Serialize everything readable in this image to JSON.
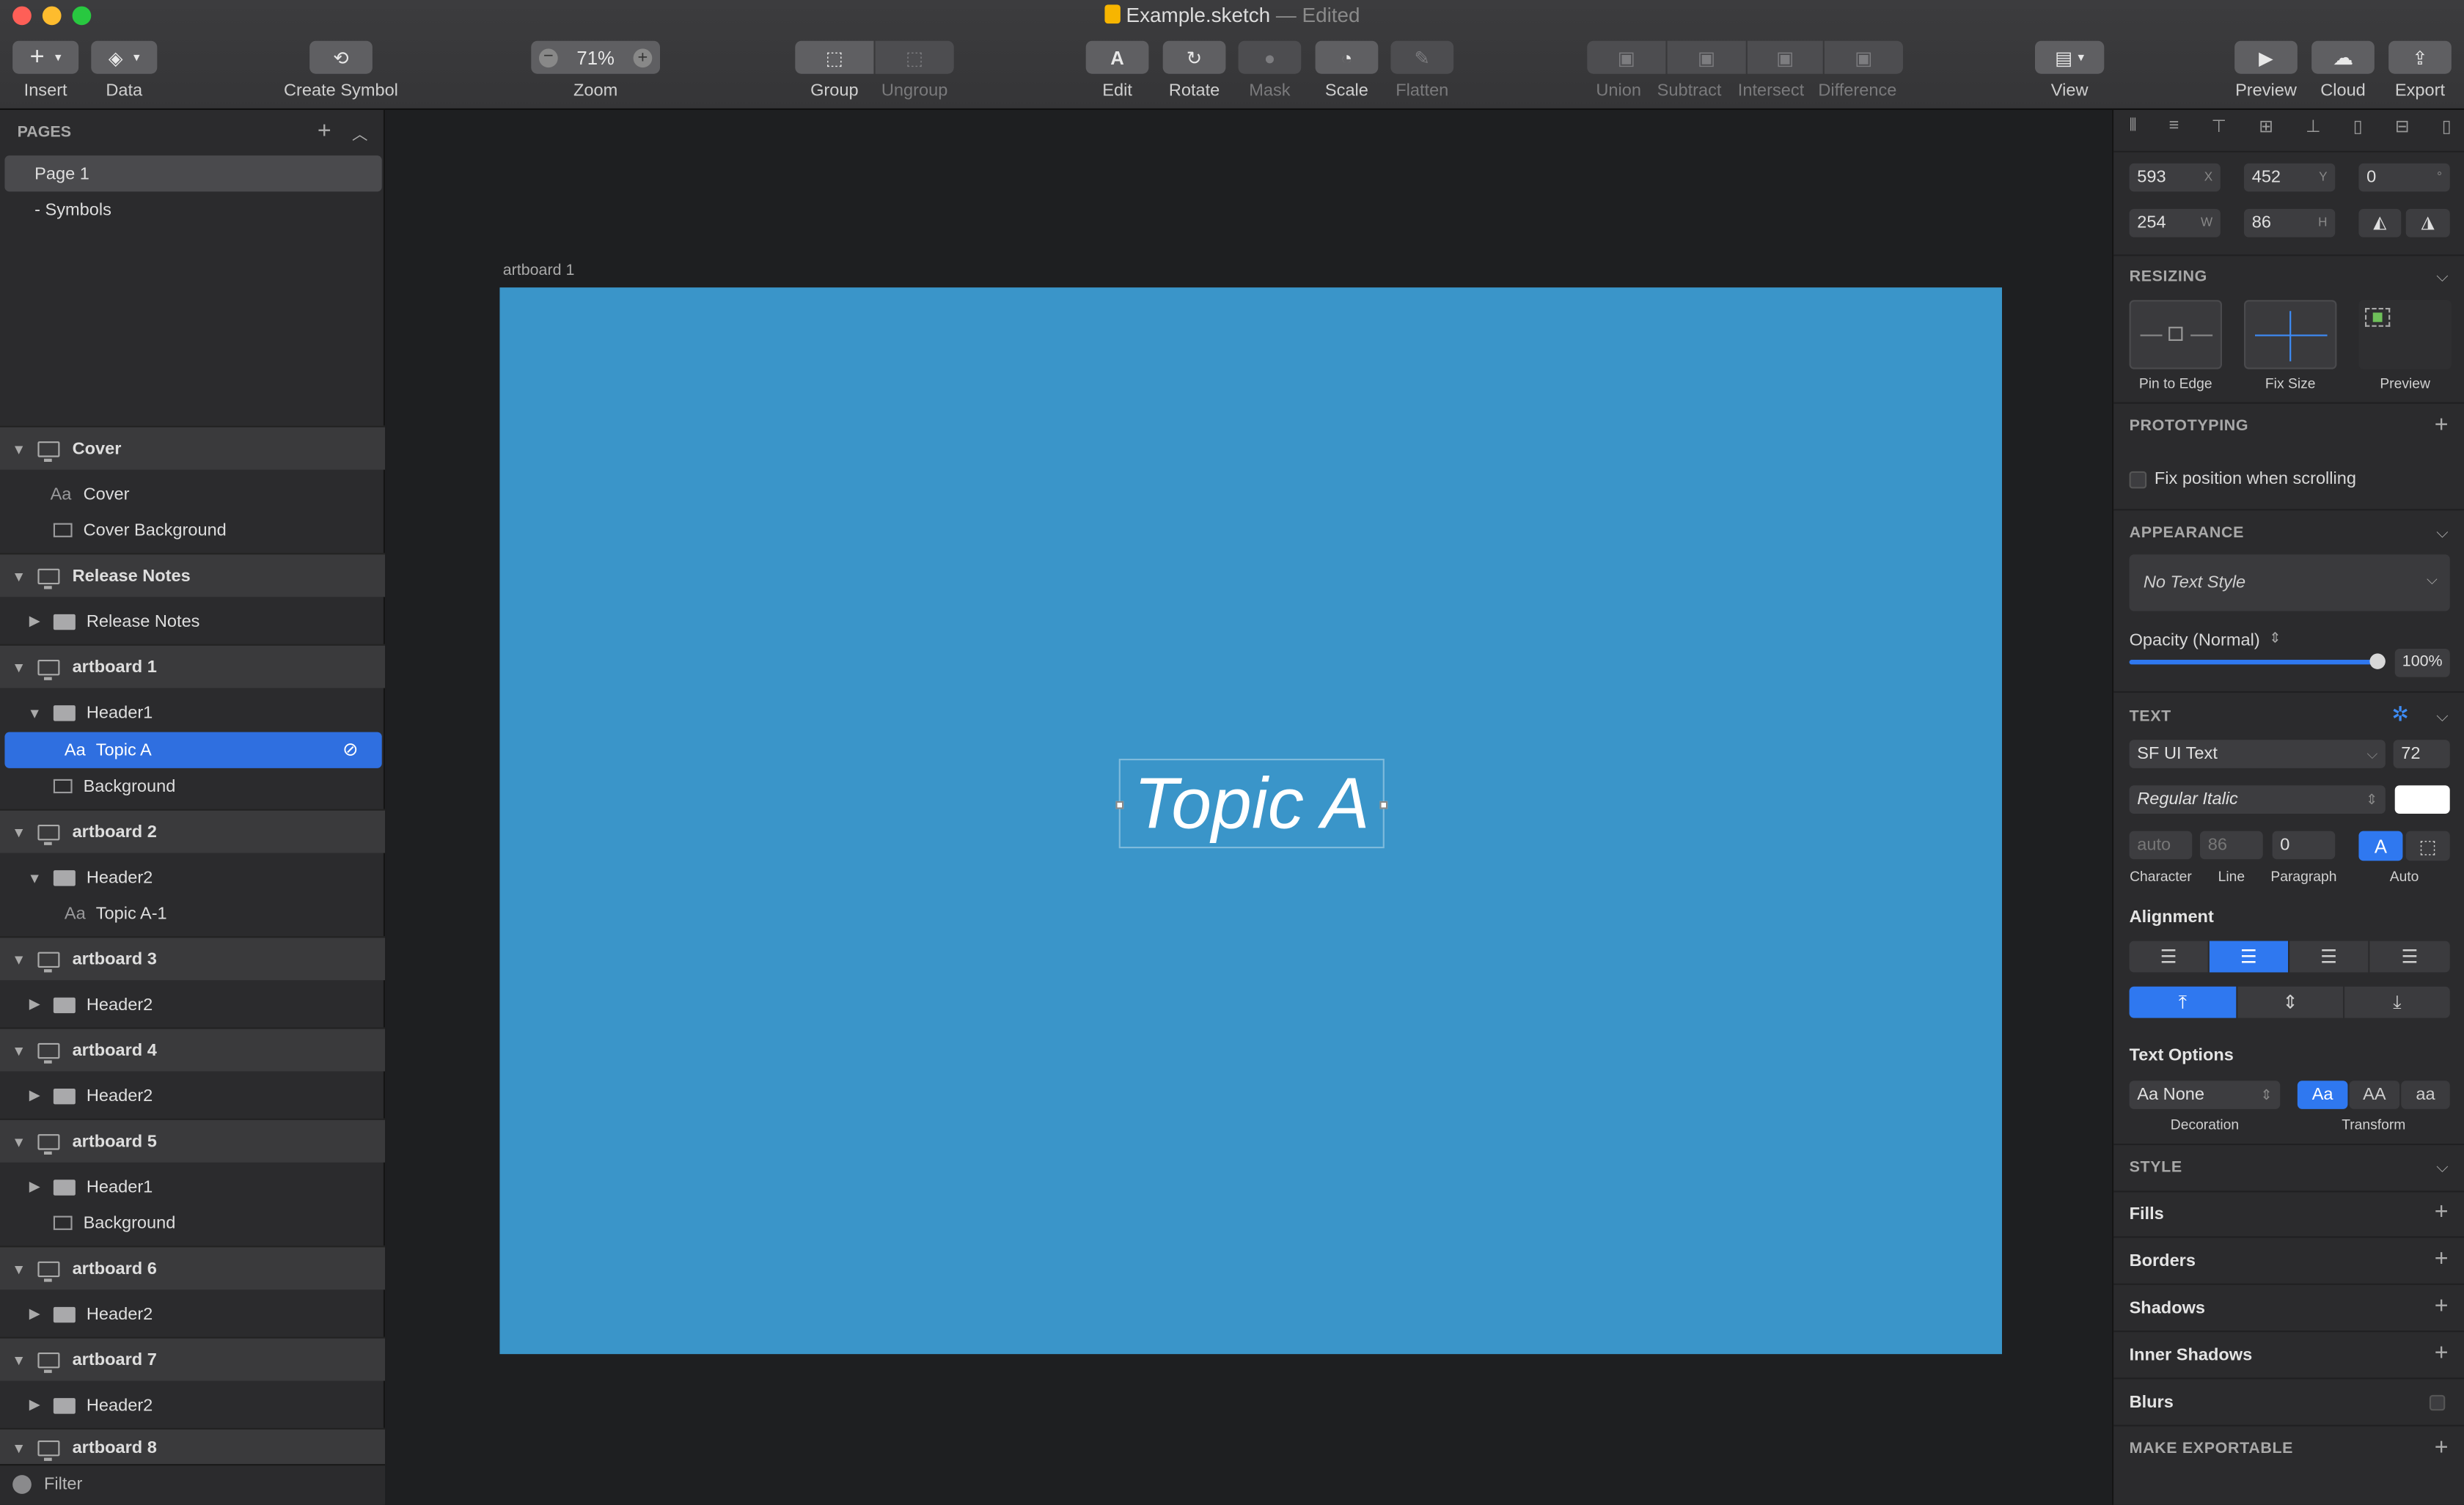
{
  "window": {
    "file_name": "Example.sketch",
    "status": "— Edited"
  },
  "toolbar": {
    "insert": "Insert",
    "data": "Data",
    "create_symbol": "Create Symbol",
    "zoom_value": "71%",
    "zoom": "Zoom",
    "group": "Group",
    "ungroup": "Ungroup",
    "edit": "Edit",
    "rotate": "Rotate",
    "mask": "Mask",
    "scale": "Scale",
    "flatten": "Flatten",
    "union": "Union",
    "subtract": "Subtract",
    "intersect": "Intersect",
    "difference": "Difference",
    "view": "View",
    "preview": "Preview",
    "cloud": "Cloud",
    "export": "Export"
  },
  "pages": {
    "title": "PAGES",
    "items": [
      "Page 1",
      "- Symbols"
    ]
  },
  "layers": [
    {
      "label": "Cover"
    },
    {
      "label": "Cover"
    },
    {
      "label": "Cover Background"
    },
    {
      "label": "Release Notes"
    },
    {
      "label": "Release Notes"
    },
    {
      "label": "artboard 1"
    },
    {
      "label": "Header1"
    },
    {
      "label": "Topic A"
    },
    {
      "label": "Background"
    },
    {
      "label": "artboard 2"
    },
    {
      "label": "Header2"
    },
    {
      "label": "Topic A-1"
    },
    {
      "label": "artboard 3"
    },
    {
      "label": "Header2"
    },
    {
      "label": "artboard 4"
    },
    {
      "label": "Header2"
    },
    {
      "label": "artboard 5"
    },
    {
      "label": "Header1"
    },
    {
      "label": "Background"
    },
    {
      "label": "artboard 6"
    },
    {
      "label": "Header2"
    },
    {
      "label": "artboard 7"
    },
    {
      "label": "Header2"
    },
    {
      "label": "artboard 8"
    }
  ],
  "filter": "Filter",
  "canvas": {
    "artboard_label": "artboard 1",
    "text": "Topic A",
    "artboard_color": "#3a95c9"
  },
  "inspector": {
    "x": "593",
    "y": "452",
    "rotation": "0",
    "w": "254",
    "h": "86",
    "x_lbl": "X",
    "y_lbl": "Y",
    "w_lbl": "W",
    "h_lbl": "H",
    "deg": "°",
    "resizing": "RESIZING",
    "pin_to_edge": "Pin to Edge",
    "fix_size": "Fix Size",
    "preview": "Preview",
    "prototyping": "PROTOTYPING",
    "fix_position": "Fix position when scrolling",
    "appearance": "APPEARANCE",
    "text_style": "No Text Style",
    "opacity_label": "Opacity (Normal)",
    "opacity_value": "100%",
    "opacity_fraction": 1.0,
    "text": "TEXT",
    "font": "SF UI Text",
    "font_size": "72",
    "font_weight": "Regular Italic",
    "character": "auto",
    "line": "86",
    "paragraph": "0",
    "character_lbl": "Character",
    "line_lbl": "Line",
    "paragraph_lbl": "Paragraph",
    "auto_lbl": "Auto",
    "alignment": "Alignment",
    "text_options": "Text Options",
    "decoration": "Aa None",
    "decoration_lbl": "Decoration",
    "transform_lbl": "Transform",
    "transform_opts": [
      "Aa",
      "AA",
      "aa"
    ],
    "style": "STYLE",
    "fills": "Fills",
    "borders": "Borders",
    "shadows": "Shadows",
    "inner_shadows": "Inner Shadows",
    "blurs": "Blurs",
    "make_exportable": "MAKE EXPORTABLE"
  }
}
